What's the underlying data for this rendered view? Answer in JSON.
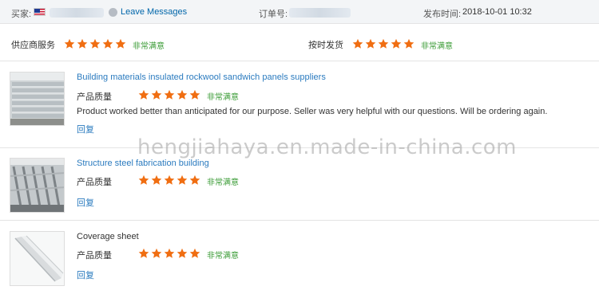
{
  "header": {
    "buyer_label": "买家:",
    "leave_messages": "Leave Messages",
    "order_label": "订单号:",
    "date_label": "发布时间:",
    "date_value": "2018-10-01 10:32",
    "country_flag": "us-flag"
  },
  "service": {
    "supplier_label": "供应商服务",
    "supplier_rating": 5,
    "supplier_text": "非常满意",
    "delivery_label": "按时发货",
    "delivery_rating": 5,
    "delivery_text": "非常满意",
    "star_color": "#f06e12"
  },
  "reviews": [
    {
      "title": "Building materials insulated rockwool sandwich panels suppliers",
      "quality_label": "产品质量",
      "rating": 5,
      "rating_text": "非常满意",
      "comment": "Product worked better than anticipated for our purpose. Seller was very helpful with our questions. Will be ordering again.",
      "reply": "回复"
    },
    {
      "title": "Structure steel fabrication building",
      "quality_label": "产品质量",
      "rating": 5,
      "rating_text": "非常满意",
      "comment": "",
      "reply": "回复"
    },
    {
      "title": "Coverage sheet",
      "quality_label": "产品质量",
      "rating": 5,
      "rating_text": "非常满意",
      "comment": "",
      "reply": "回复"
    }
  ],
  "watermark": "hengjiahaya.en.made-in-china.com"
}
